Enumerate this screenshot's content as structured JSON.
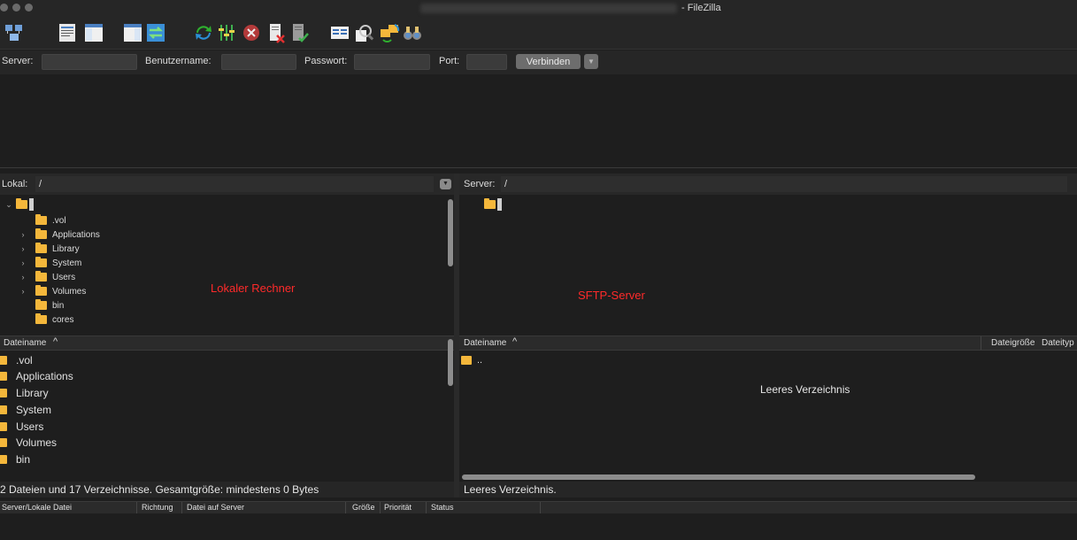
{
  "window": {
    "title_suffix": "- FileZilla"
  },
  "toolbar": {
    "icons": [
      "site-manager",
      "toggle-log",
      "toggle-local-tree",
      "toggle-remote-tree",
      "toggle-queue",
      "refresh",
      "process-queue",
      "cancel",
      "disconnect",
      "reconnect",
      "directory-listing-filters",
      "compare-directories",
      "synchronized-browsing",
      "search-remote-files"
    ]
  },
  "quickconnect": {
    "server_label": "Server:",
    "username_label": "Benutzername:",
    "password_label": "Passwort:",
    "port_label": "Port:",
    "connect_label": "Verbinden",
    "server_value": "",
    "username_value": "",
    "password_value": "",
    "port_value": ""
  },
  "local": {
    "path_label": "Lokal:",
    "path_value": "/",
    "tree": [
      {
        "label": "/",
        "expanded": true,
        "root": true
      },
      {
        "label": ".vol",
        "has_children": false
      },
      {
        "label": "Applications",
        "has_children": true
      },
      {
        "label": "Library",
        "has_children": true
      },
      {
        "label": "System",
        "has_children": true
      },
      {
        "label": "Users",
        "has_children": true
      },
      {
        "label": "Volumes",
        "has_children": true
      },
      {
        "label": "bin",
        "has_children": false
      },
      {
        "label": "cores",
        "has_children": false
      }
    ],
    "overlay_label": "Lokaler Rechner",
    "column_filename": "Dateiname",
    "files": [
      ".vol",
      "Applications",
      "Library",
      "System",
      "Users",
      "Volumes",
      "bin"
    ],
    "status": "2 Dateien und 17 Verzeichnisse. Gesamtgröße: mindestens 0 Bytes"
  },
  "remote": {
    "path_label": "Server:",
    "path_value": "/",
    "tree_root": "/",
    "overlay_label": "SFTP-Server",
    "column_filename": "Dateiname",
    "column_filesize": "Dateigröße",
    "column_filetype": "Dateityp",
    "files": [
      ".."
    ],
    "empty_message": "Leeres Verzeichnis",
    "status": "Leeres Verzeichnis."
  },
  "queue": {
    "columns": [
      "Server/Lokale Datei",
      "Richtung",
      "Datei auf Server",
      "Größe",
      "Priorität",
      "Status"
    ]
  },
  "colors": {
    "background": "#1e1e1e",
    "folder": "#f4b73b",
    "annotation": "#ff2a2a"
  }
}
